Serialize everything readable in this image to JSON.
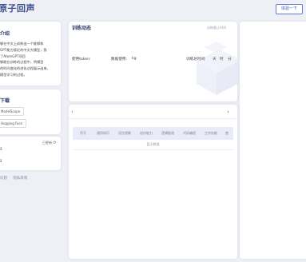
{
  "header": {
    "brand": "原子回声",
    "try_button": "体验一下"
  },
  "intro": {
    "title": "介绍",
    "lines": [
      "够在中文上训练出一个能够和",
      "GPT能力接近的中文大模型，我",
      "了AtomGPT项目",
      "够能在训练的过程中，将模型",
      "的时间变化的进化过程展示出来，",
      "模型学习的过程。"
    ]
  },
  "download": {
    "title": "下载",
    "items": [
      "ModelScope",
      "Hugging Face"
    ]
  },
  "stats": {
    "updated": "已更新",
    "updated_icon": "refresh-icon",
    "labels": [
      ":",
      ":"
    ]
  },
  "footer_links": [
    "问题",
    "隐私政策"
  ],
  "training": {
    "title": "训练动态",
    "deadline_label": "训练截止时间",
    "token_label": "使用token:",
    "data_label": "数据使用:",
    "data_unit": "kg",
    "total_time_label": "训练总时间:",
    "day_unit": "天",
    "hour_unit": "时",
    "minute_unit": "分"
  },
  "panel": {
    "prev": "‹",
    "next": "›",
    "columns": [
      "序号",
      "通用知识",
      "语言理解",
      "创作能力",
      "逻辑推理",
      "代码编程",
      "工作技能",
      "使"
    ],
    "empty_text": "暂无数据"
  }
}
